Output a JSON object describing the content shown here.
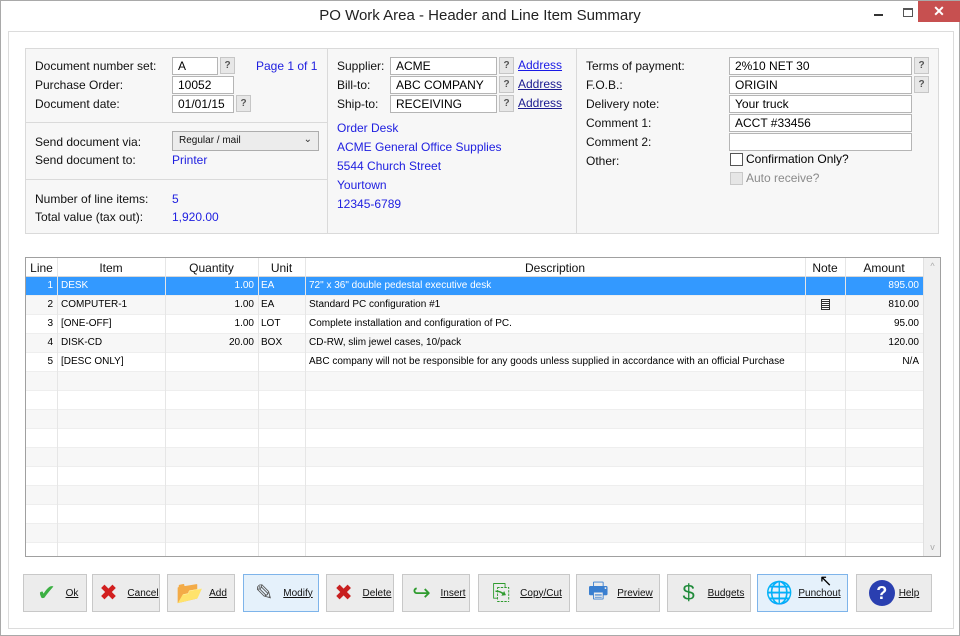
{
  "window": {
    "title": "PO Work Area - Header and Line Item Summary",
    "controls": {
      "minimize": "minimize",
      "maximize": "maximize",
      "close": "✕"
    }
  },
  "header": {
    "left": {
      "doc_number_set_label": "Document number set:",
      "doc_number_set_value": "A",
      "page_info": "Page 1 of 1",
      "purchase_order_label": "Purchase Order:",
      "purchase_order_value": "10052",
      "doc_date_label": "Document date:",
      "doc_date_value": "01/01/15",
      "send_via_label": "Send document via:",
      "send_via_value": "Regular / mail",
      "send_to_label": "Send document to:",
      "send_to_value": "Printer",
      "line_items_label": "Number of line items:",
      "line_items_value": "5",
      "total_label": "Total value (tax out):",
      "total_value": "1,920.00"
    },
    "middle": {
      "supplier_label": "Supplier:",
      "supplier_value": "ACME",
      "bill_to_label": "Bill-to:",
      "bill_to_value": "ABC COMPANY",
      "ship_to_label": "Ship-to:",
      "ship_to_value": "RECEIVING",
      "address_link": "Address",
      "address_lines": [
        "Order Desk",
        "ACME General Office Supplies",
        "5544 Church Street",
        "Yourtown",
        "12345-6789"
      ]
    },
    "right": {
      "terms_label": "Terms of payment:",
      "terms_value": "2%10 NET 30",
      "fob_label": "F.O.B.:",
      "fob_value": "ORIGIN",
      "delivery_label": "Delivery note:",
      "delivery_value": "Your truck",
      "comment1_label": "Comment 1:",
      "comment1_value": "ACCT #33456",
      "comment2_label": "Comment 2:",
      "comment2_value": "",
      "other_label": "Other:",
      "confirmation_label": "Confirmation Only?",
      "confirmation_checked": false,
      "auto_receive_label": "Auto receive?",
      "auto_receive_checked": false
    },
    "help_glyph": "?"
  },
  "grid": {
    "columns": [
      "Line",
      "Item",
      "Quantity",
      "Unit",
      "Description",
      "Note",
      "Amount"
    ],
    "rows": [
      {
        "line": "1",
        "item": "DESK",
        "quantity": "1.00",
        "unit": "EA",
        "description": "72\" x 36\" double pedestal executive desk",
        "note": false,
        "amount": "895.00",
        "selected": true
      },
      {
        "line": "2",
        "item": "COMPUTER-1",
        "quantity": "1.00",
        "unit": "EA",
        "description": "Standard PC configuration #1",
        "note": true,
        "amount": "810.00",
        "selected": false
      },
      {
        "line": "3",
        "item": "[ONE-OFF]",
        "quantity": "1.00",
        "unit": "LOT",
        "description": "Complete installation and configuration of PC.",
        "note": false,
        "amount": "95.00",
        "selected": false
      },
      {
        "line": "4",
        "item": "DISK-CD",
        "quantity": "20.00",
        "unit": "BOX",
        "description": "CD-RW, slim jewel cases, 10/pack",
        "note": false,
        "amount": "120.00",
        "selected": false
      },
      {
        "line": "5",
        "item": "[DESC ONLY]",
        "quantity": "",
        "unit": "",
        "description": "ABC company will not be responsible for any goods unless supplied in accordance with an official Purchase",
        "note": false,
        "amount": "N/A",
        "selected": false
      }
    ],
    "empty_rows": 10,
    "scroll_up": "^",
    "scroll_down": "v"
  },
  "buttons": [
    {
      "id": "ok",
      "label": "Ok",
      "icon": "checkmark-icon",
      "glyph": "✔",
      "color": "#3cb043"
    },
    {
      "id": "cancel",
      "label": "Cancel",
      "icon": "x-icon",
      "glyph": "✖",
      "color": "#d21f1f"
    },
    {
      "id": "add",
      "label": "Add",
      "icon": "folder-add-icon",
      "glyph": "📂",
      "color": "#e8b030"
    },
    {
      "id": "modify",
      "label": "Modify",
      "icon": "edit-document-icon",
      "glyph": "✎",
      "color": "#555555"
    },
    {
      "id": "delete",
      "label": "Delete",
      "icon": "delete-document-icon",
      "glyph": "✖",
      "color": "#c82020"
    },
    {
      "id": "insert",
      "label": "Insert",
      "icon": "insert-icon",
      "glyph": "↪",
      "color": "#2e9b2e"
    },
    {
      "id": "copy_cut",
      "label": "Copy/Cut",
      "icon": "copy-icon",
      "glyph": "⎘",
      "color": "#2e9b2e"
    },
    {
      "id": "preview",
      "label": "Preview",
      "icon": "printer-icon",
      "glyph": "🖶",
      "color": "#3a7fd0"
    },
    {
      "id": "budgets",
      "label": "Budgets",
      "icon": "magnifier-dollar-icon",
      "glyph": "$",
      "color": "#1f8a3a"
    },
    {
      "id": "punchout",
      "label": "Punchout",
      "icon": "globe-icon",
      "glyph": "🌐",
      "color": "#2a6fc4"
    },
    {
      "id": "help",
      "label": "Help",
      "icon": "help-icon",
      "glyph": "?",
      "color": "#2a3fb0"
    }
  ]
}
